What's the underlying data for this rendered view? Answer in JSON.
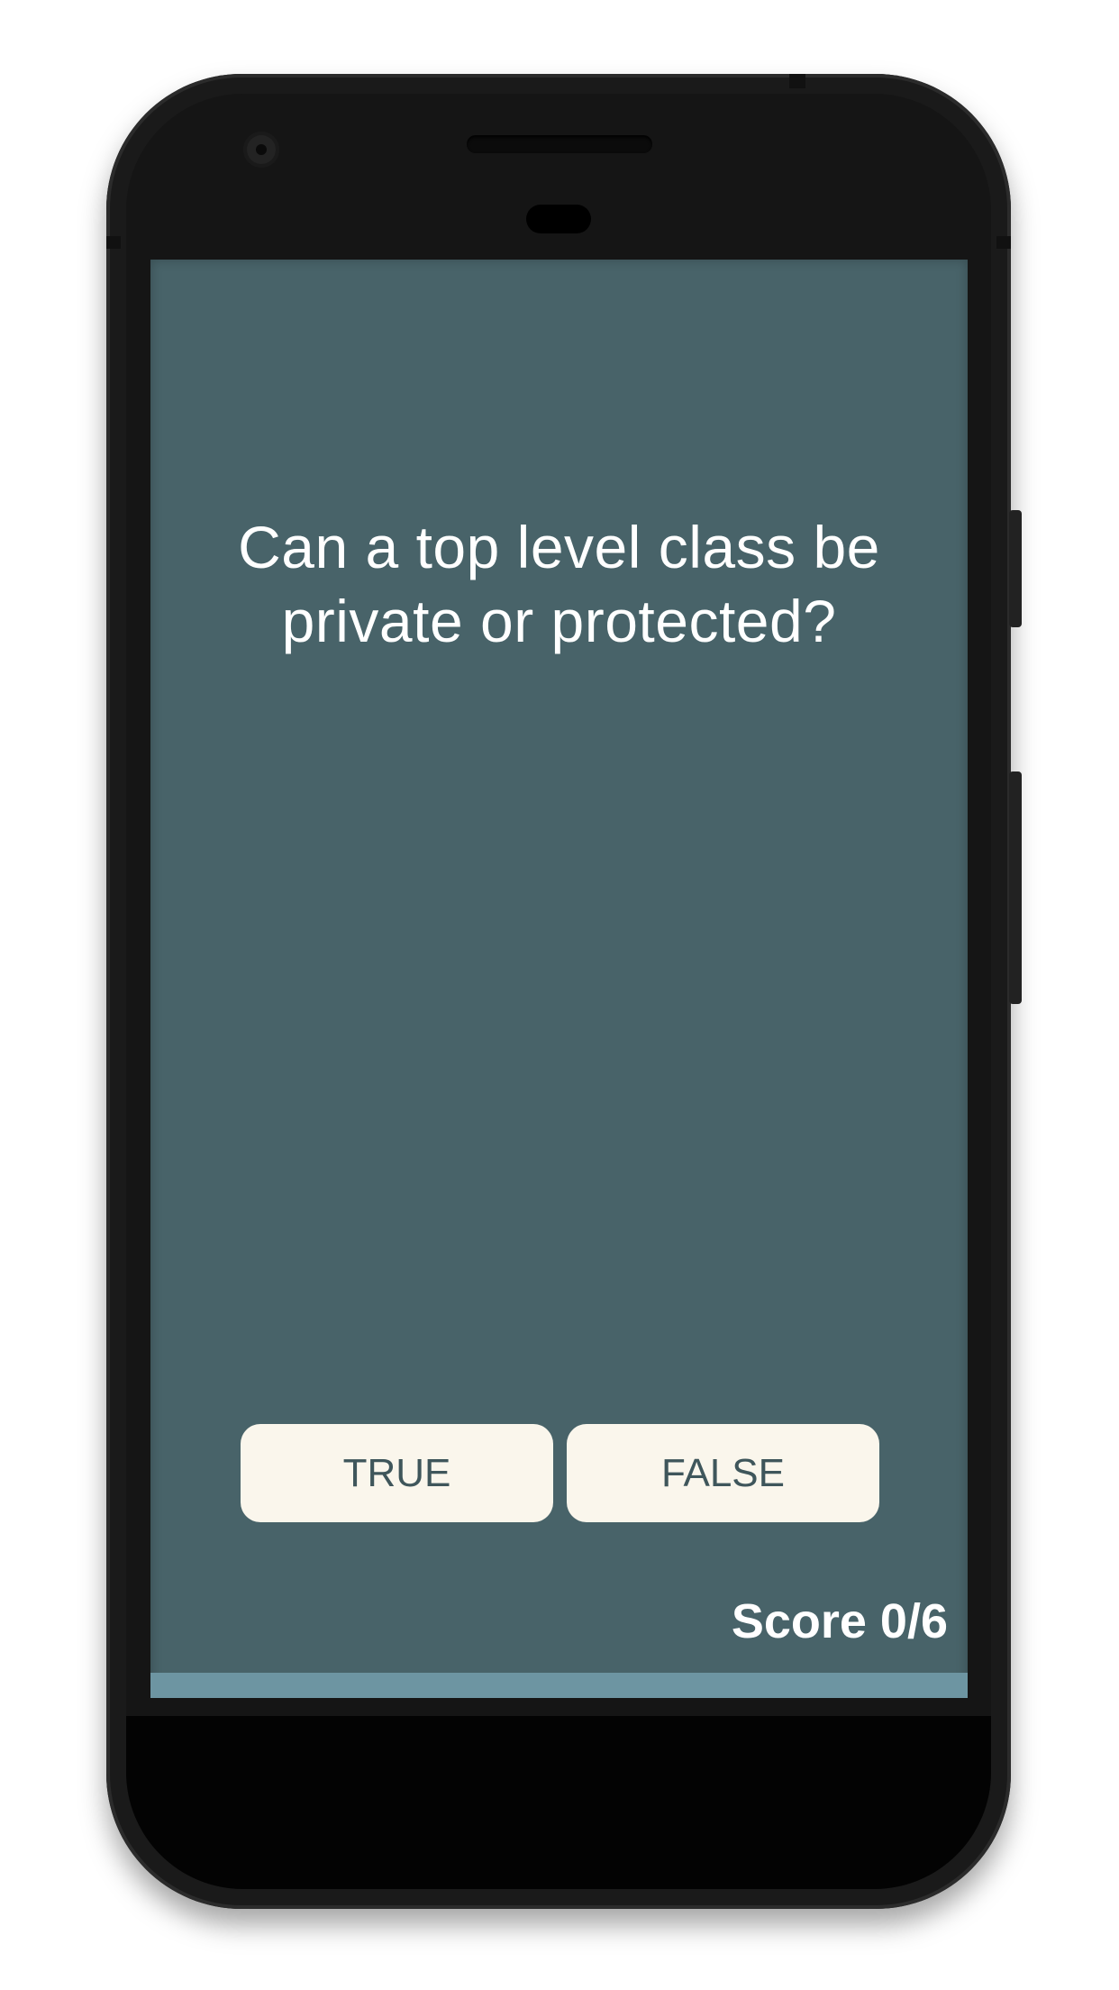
{
  "question": {
    "line1": "Can a top level class be",
    "line2": "private or protected?"
  },
  "answers": {
    "true_label": "TRUE",
    "false_label": "FALSE"
  },
  "score": {
    "label": "Score 0/6"
  },
  "progress": {
    "fraction": 0
  },
  "colors": {
    "screen_background": "#486369",
    "button_background": "#faf6ec",
    "button_text": "#3f565b",
    "progress_bar": "#6d95a2"
  }
}
